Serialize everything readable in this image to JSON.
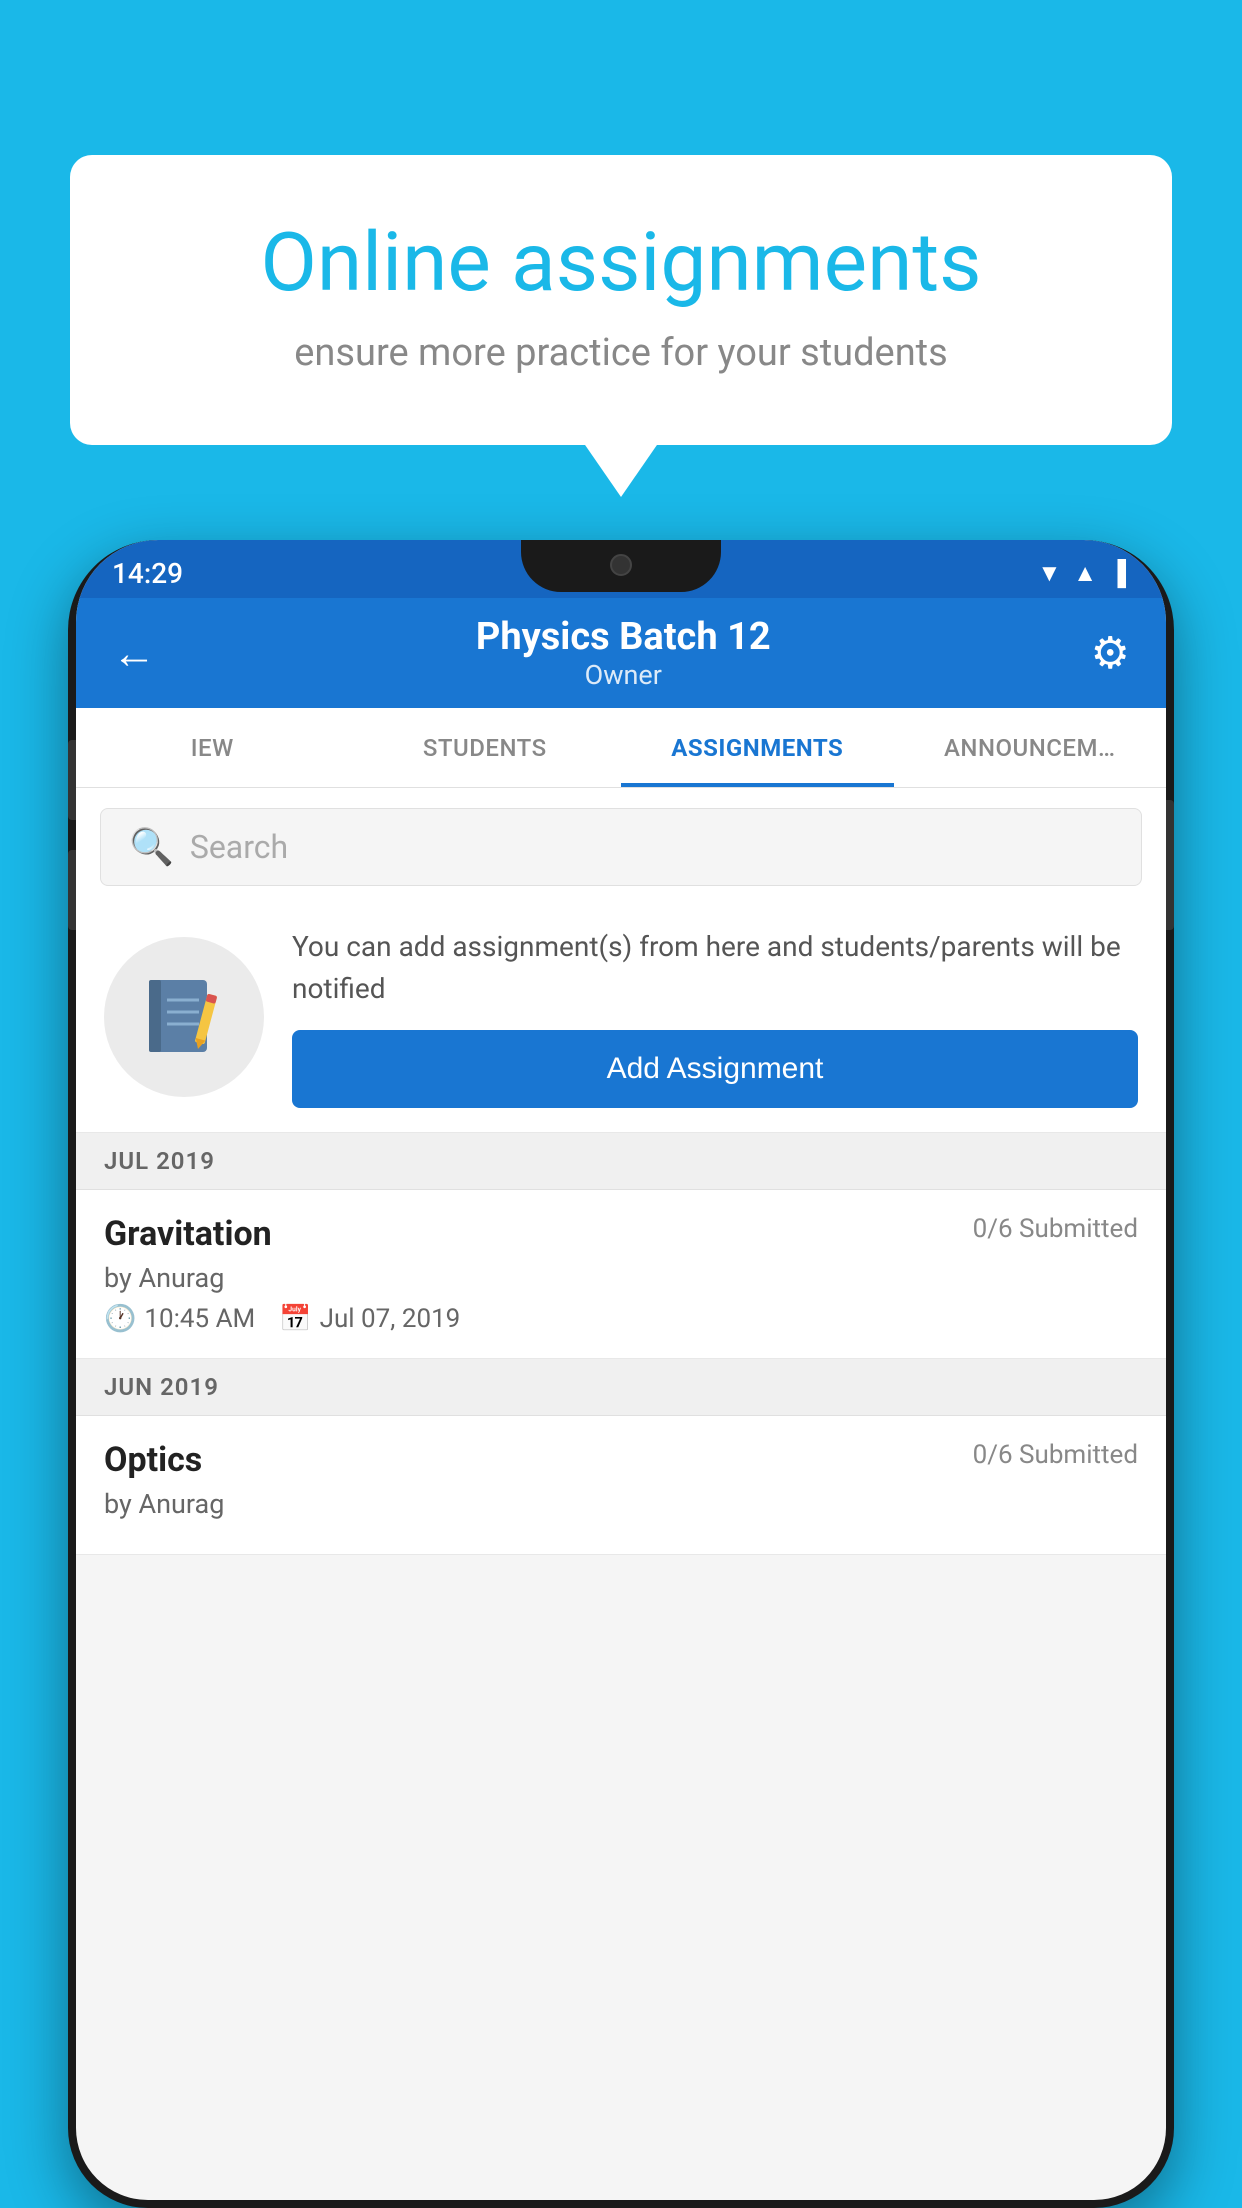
{
  "background_color": "#1ab8e8",
  "speech_bubble": {
    "title": "Online assignments",
    "subtitle": "ensure more practice for your students"
  },
  "status_bar": {
    "time": "14:29",
    "icons": [
      "wifi",
      "signal",
      "battery"
    ]
  },
  "app_header": {
    "title": "Physics Batch 12",
    "subtitle": "Owner",
    "back_label": "←",
    "gear_label": "⚙"
  },
  "tabs": [
    {
      "label": "IEW",
      "active": false
    },
    {
      "label": "STUDENTS",
      "active": false
    },
    {
      "label": "ASSIGNMENTS",
      "active": true
    },
    {
      "label": "ANNOUNCEM…",
      "active": false
    }
  ],
  "search": {
    "placeholder": "Search"
  },
  "add_assignment": {
    "description": "You can add assignment(s) from here and students/parents will be notified",
    "button_label": "Add Assignment"
  },
  "sections": [
    {
      "month_label": "JUL 2019",
      "assignments": [
        {
          "title": "Gravitation",
          "submitted": "0/6 Submitted",
          "by": "by Anurag",
          "time": "10:45 AM",
          "date": "Jul 07, 2019"
        }
      ]
    },
    {
      "month_label": "JUN 2019",
      "assignments": [
        {
          "title": "Optics",
          "submitted": "0/6 Submitted",
          "by": "by Anurag",
          "time": "",
          "date": ""
        }
      ]
    }
  ]
}
